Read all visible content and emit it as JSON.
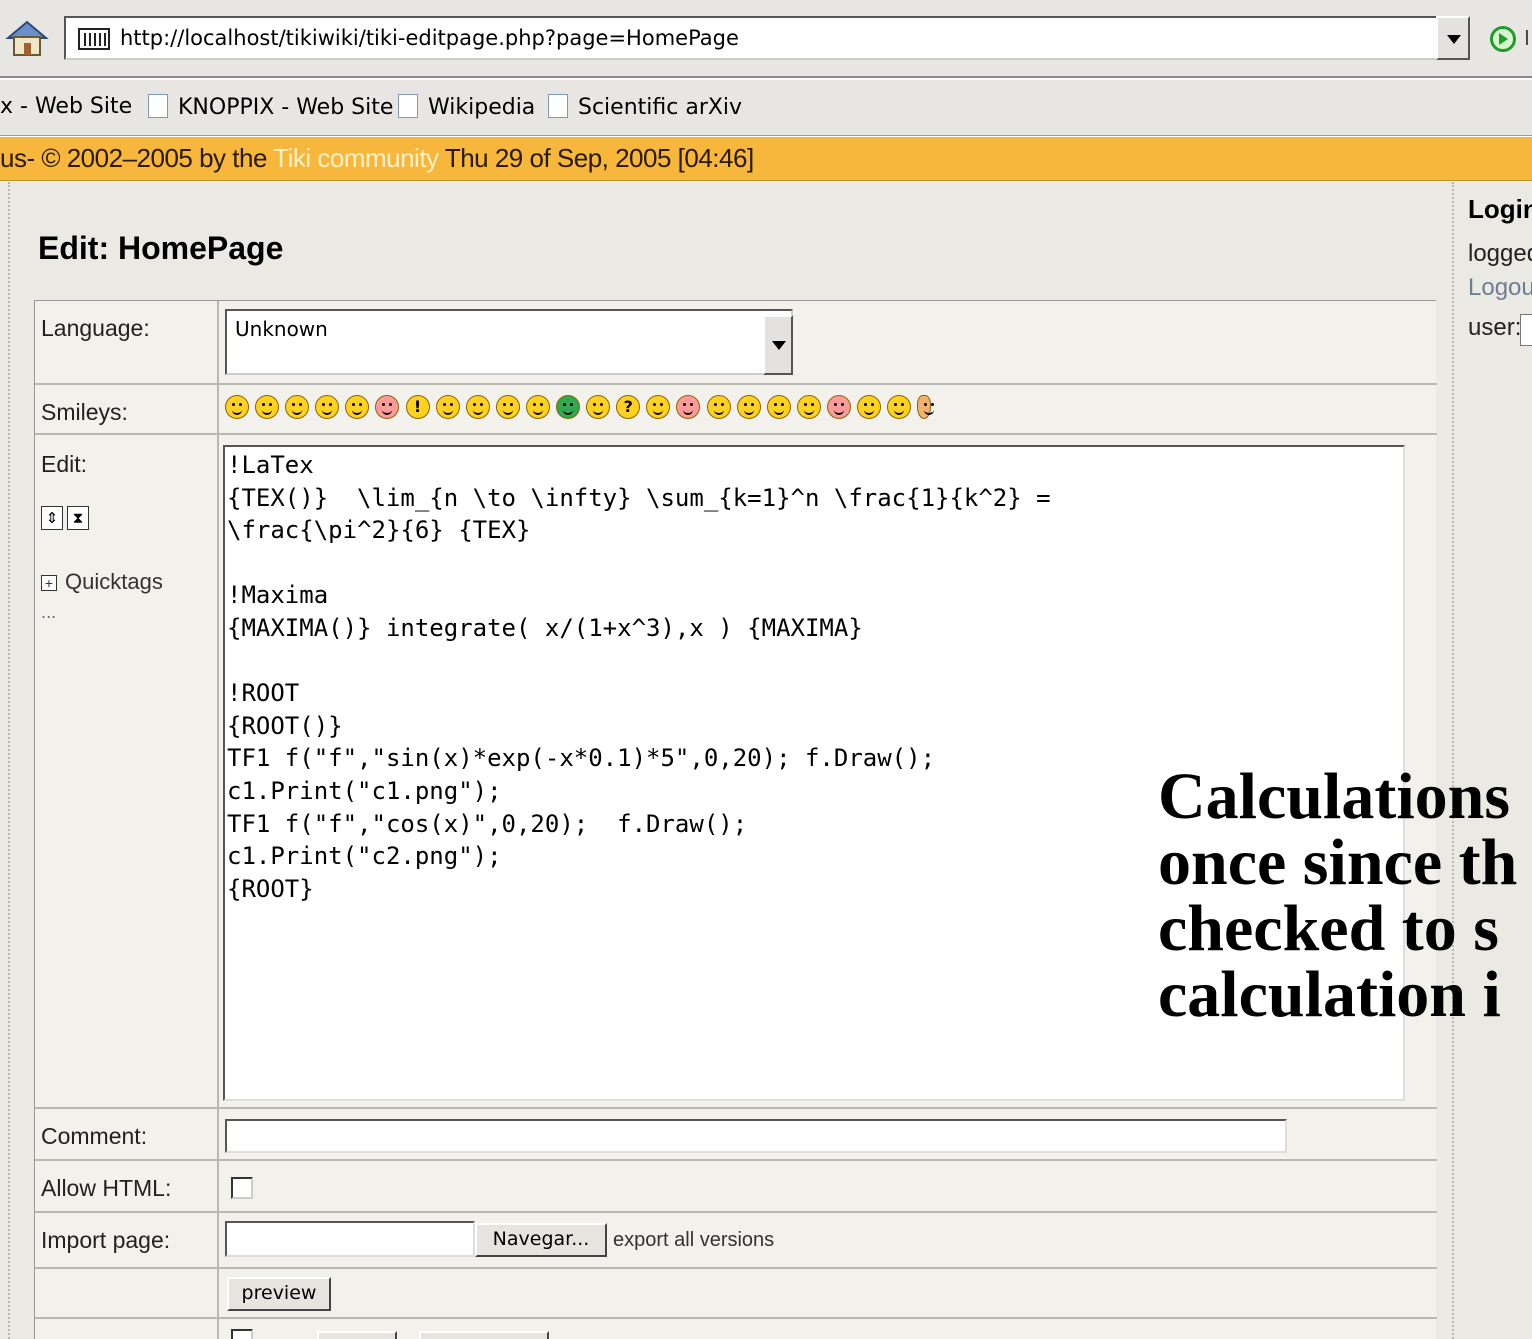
{
  "browser": {
    "url": "http://localhost/tikiwiki/tiki-editpage.php?page=HomePage",
    "go_label": "I",
    "bookmarks": [
      "x - Web Site",
      "KNOPPIX - Web Site",
      "Wikipedia",
      "Scientific arXiv"
    ]
  },
  "status_bar": {
    "prefix": "us- © 2002–2005 by the ",
    "community": "Tiki community",
    "date": " Thu 29 of Sep, 2005 [04:46]"
  },
  "login_box": {
    "title": "Login",
    "line1": "logged",
    "logout": "Logout",
    "user_label": "user:"
  },
  "page_title": "Edit: HomePage",
  "form": {
    "language_label": "Language:",
    "language_value": "Unknown",
    "smileys_label": "Smileys:",
    "edit_label": "Edit:",
    "quicktags_label": "Quicktags",
    "quicktags_more": "...",
    "editor_content": "!LaTex\n{TEX()}  \\lim_{n \\to \\infty} \\sum_{k=1}^n \\frac{1}{k^2} =\n\\frac{\\pi^2}{6} {TEX}\n\n!Maxima\n{MAXIMA()} integrate( x/(1+x^3),x ) {MAXIMA}\n\n!ROOT\n{ROOT()}\nTF1 f(\"f\",\"sin(x)*exp(-x*0.1)*5\",0,20); f.Draw();\nc1.Print(\"c1.png\");\nTF1 f(\"f\",\"cos(x)\",0,20);  f.Draw();\nc1.Print(\"c2.png\");\n{ROOT}",
    "comment_label": "Comment:",
    "allow_html_label": "Allow HTML:",
    "import_label": "Import page:",
    "browse_button": "Navegar...",
    "export_link": "export all versions",
    "preview_button": "preview"
  },
  "overlay_text": [
    "Calculations",
    "once since th",
    "checked to s",
    "calculation i"
  ],
  "colors": {
    "status_bar": "#f6b73c",
    "page_bg": "#ebe9e4",
    "link": "#6f7f93"
  }
}
